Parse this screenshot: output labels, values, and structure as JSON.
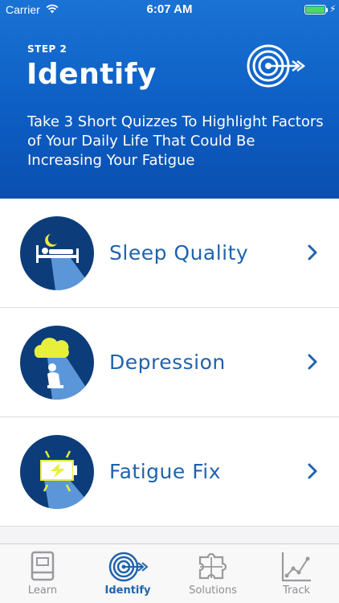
{
  "status": {
    "carrier": "Carrier",
    "time": "6:07 AM"
  },
  "header": {
    "step": "STEP 2",
    "title": "Identify",
    "subtitle": "Take 3 Short Quizzes To Highlight Factors of Your Daily Life That Could Be Increasing Your Fatigue"
  },
  "quizzes": [
    {
      "label": "Sleep Quality",
      "icon": "sleep-bed-moon-icon"
    },
    {
      "label": "Depression",
      "icon": "raincloud-person-icon"
    },
    {
      "label": "Fatigue Fix",
      "icon": "battery-lightning-icon"
    }
  ],
  "tabs": [
    {
      "label": "Learn",
      "icon": "book-icon",
      "active": false
    },
    {
      "label": "Identify",
      "icon": "target-icon",
      "active": true
    },
    {
      "label": "Solutions",
      "icon": "puzzle-icon",
      "active": false
    },
    {
      "label": "Track",
      "icon": "line-graph-icon",
      "active": false
    }
  ],
  "colors": {
    "accent": "#1f63ad",
    "header": "#0d5ec4",
    "icon_circle": "#0c3d7a",
    "inactive_tab": "#8e8e93"
  }
}
